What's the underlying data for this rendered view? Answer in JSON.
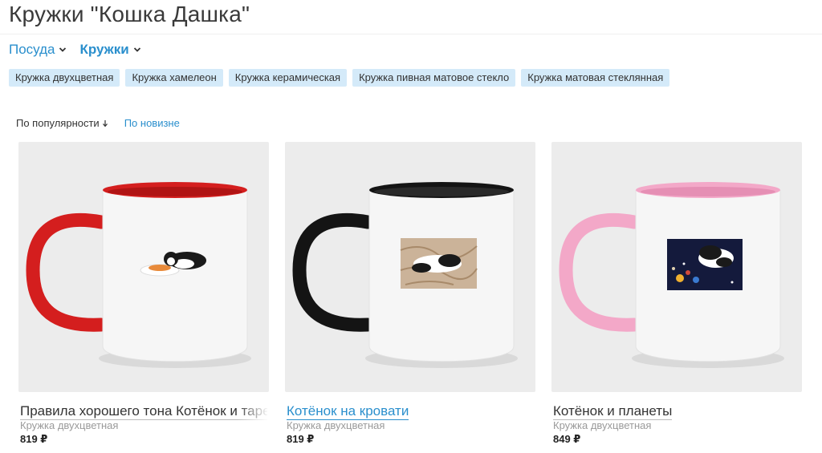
{
  "page": {
    "title": "Кружки \"Кошка Дашка\""
  },
  "breadcrumbs": [
    {
      "label": "Посуда",
      "icon": "chevron-down-icon"
    },
    {
      "label": "Кружки",
      "icon": "chevron-down-icon",
      "active": true
    }
  ],
  "tags": [
    "Кружка двухцветная",
    "Кружка хамелеон",
    "Кружка керамическая",
    "Кружка пивная матовое стекло",
    "Кружка матовая стеклянная"
  ],
  "sort": {
    "active_label": "По популярности",
    "active_icon": "arrow-down-icon",
    "other_label": "По новизне"
  },
  "colors": {
    "accent": "#2a8fcd",
    "tag_bg": "#d4eaf9",
    "card_bg": "#ececec"
  },
  "products": [
    {
      "title": "Правила хорошего тона Котёнок и таре",
      "type": "Кружка двухцветная",
      "price": "819 ₽",
      "mug_accent": "#d41e1e",
      "print": "cat-with-plate"
    },
    {
      "title": "Котёнок на кровати",
      "type": "Кружка двухцветная",
      "price": "819 ₽",
      "mug_accent": "#141414",
      "print": "cat-on-bed"
    },
    {
      "title": "Котёнок и планеты",
      "type": "Кружка двухцветная",
      "price": "849 ₽",
      "mug_accent": "#f3a8c8",
      "print": "cat-and-planets"
    }
  ]
}
